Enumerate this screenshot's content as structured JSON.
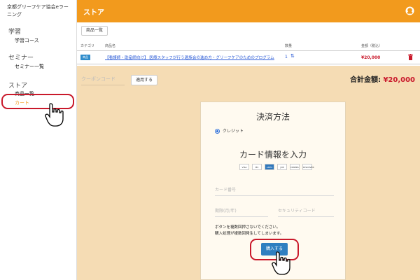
{
  "sidebar": {
    "org_name": "京都グリーフケア協会eラーニング",
    "learn": "学習",
    "courses": "学習コース",
    "seminar": "セミナー",
    "seminar_list": "セミナー一覧",
    "store": "ストア",
    "products": "商品一覧",
    "cart": "カート"
  },
  "header": {
    "title": "ストア",
    "avatar_icon": "user-icon"
  },
  "toolbar": {
    "back_label": "商品一覧"
  },
  "table": {
    "headers": {
      "category": "カテゴリ",
      "product": "商品名",
      "qty": "数量",
      "price": "金額（税込）"
    },
    "rows": [
      {
        "thumb": "商品",
        "title": "【看護師・助産師向け】 医療スタッフが行う遺族会の進め方・グリーフケアのためのプログラム",
        "qty": "1",
        "price": "¥20,000"
      }
    ]
  },
  "coupon": {
    "placeholder": "クーポンコード",
    "apply_label": "適用する"
  },
  "total": {
    "label": "合計金額:",
    "amount": "¥20,000"
  },
  "payment": {
    "title": "決済方法",
    "method_label": "クレジット",
    "card_heading": "カード情報を入力",
    "card_logos": [
      "VISA",
      "MC",
      "AMEX",
      "JCB",
      "DINERS",
      "DISCOVER"
    ],
    "card_number_placeholder": "カード番号",
    "expiry_placeholder": "期限(月/年)",
    "cvc_placeholder": "セキュリティコード",
    "warning_line1": "ボタンを複数回押さないでください。",
    "warning_line2": "購入処理が複数回発生してしまいます。",
    "buy_label": "購入する"
  },
  "colors": {
    "header": "#f29a1d",
    "background": "#f5dcb4",
    "highlight_ring": "#c9192b",
    "buy_button": "#2f7fc0"
  }
}
